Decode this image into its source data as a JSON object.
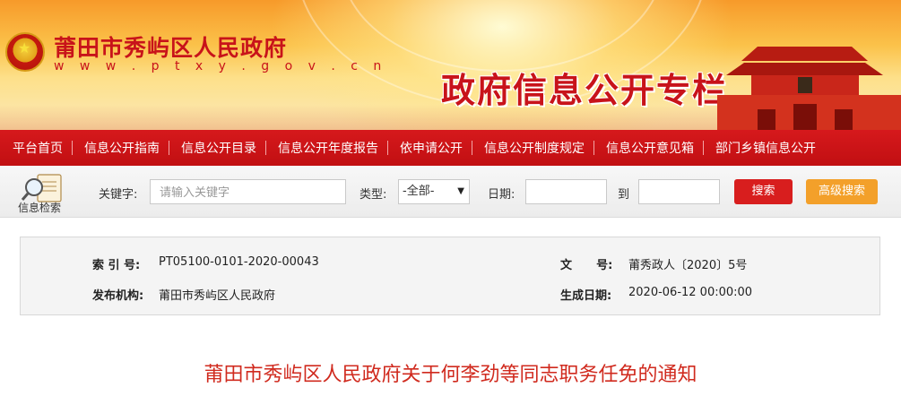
{
  "header": {
    "site_title": "莆田市秀屿区人民政府",
    "site_url": "w w w . p t x y . g o v . c n",
    "slogan": "政府信息公开专栏",
    "brand_color": "#c8131a"
  },
  "nav": {
    "items": [
      {
        "label": "平台首页"
      },
      {
        "label": "信息公开指南"
      },
      {
        "label": "信息公开目录"
      },
      {
        "label": "信息公开年度报告"
      },
      {
        "label": "依申请公开"
      },
      {
        "label": "信息公开制度规定"
      },
      {
        "label": "信息公开意见箱"
      },
      {
        "label": "部门乡镇信息公开"
      }
    ]
  },
  "search": {
    "icon_label": "信息检索",
    "keyword_label": "关键字:",
    "keyword_placeholder": "请输入关键字",
    "type_label": "类型:",
    "type_selected": "-全部-",
    "date_label": "日期:",
    "date_to_label": "到",
    "search_button": "搜索",
    "advanced_button": "高级搜索"
  },
  "info": {
    "index_label": "索 引 号:",
    "index_value": "PT05100-0101-2020-00043",
    "doc_no_label": "文      号:",
    "doc_no_value": "莆秀政人〔2020〕5号",
    "publisher_label": "发布机构:",
    "publisher_value": "莆田市秀屿区人民政府",
    "date_label": "生成日期:",
    "date_value": "2020-06-12 00:00:00"
  },
  "document": {
    "title": "莆田市秀屿区人民政府关于何李劲等同志职务任免的通知"
  }
}
